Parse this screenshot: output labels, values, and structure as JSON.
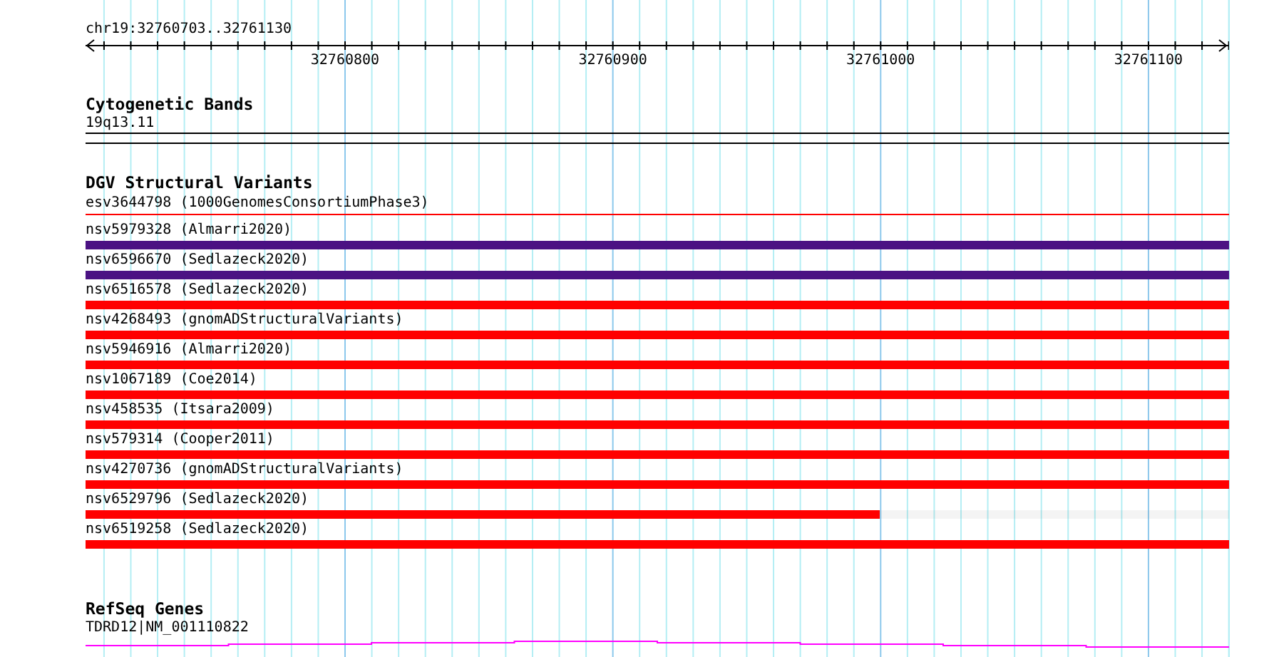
{
  "ruler": {
    "location": "chr19:32760703..32761130",
    "tick_labels": [
      "32760800",
      "32760900",
      "32761000",
      "32761100"
    ]
  },
  "tracks": [
    {
      "kind": "band",
      "title": "Cytogenetic Bands",
      "label": "19q13.11"
    },
    {
      "kind": "variants",
      "title": "DGV Structural Variants",
      "features": [
        {
          "kind": "thin",
          "label": "esv3644798 (1000GenomesConsortiumPhase3)",
          "color": "#ff0000"
        },
        {
          "kind": "thick",
          "label": "nsv5979328 (Almarri2020)",
          "color": "#4b1283"
        },
        {
          "kind": "thick",
          "label": "nsv6596670 (Sedlazeck2020)",
          "color": "#4b1283"
        },
        {
          "kind": "thick",
          "label": "nsv6516578 (Sedlazeck2020)",
          "color": "#ff0000"
        },
        {
          "kind": "thick",
          "label": "nsv4268493 (gnomADStructuralVariants)",
          "color": "#ff0000"
        },
        {
          "kind": "thick",
          "label": "nsv5946916 (Almarri2020)",
          "color": "#ff0000"
        },
        {
          "kind": "thick",
          "label": "nsv1067189 (Coe2014)",
          "color": "#ff0000"
        },
        {
          "kind": "thick",
          "label": "nsv458535 (Itsara2009)",
          "color": "#ff0000"
        },
        {
          "kind": "thick",
          "label": "nsv579314 (Cooper2011)",
          "color": "#ff0000"
        },
        {
          "kind": "thick",
          "label": "nsv4270736 (gnomADStructuralVariants)",
          "color": "#ff0000"
        },
        {
          "kind": "thick",
          "label": "nsv6529796 (Sedlazeck2020)",
          "color": "#ff0000",
          "level": 0.695
        },
        {
          "kind": "thick",
          "label": "nsv6519258 (Sedlazeck2020)",
          "color": "#ff0000"
        }
      ]
    },
    {
      "kind": "gene",
      "title": "RefSeq Genes",
      "label": "TDRD12|NM_001110822"
    }
  ]
}
